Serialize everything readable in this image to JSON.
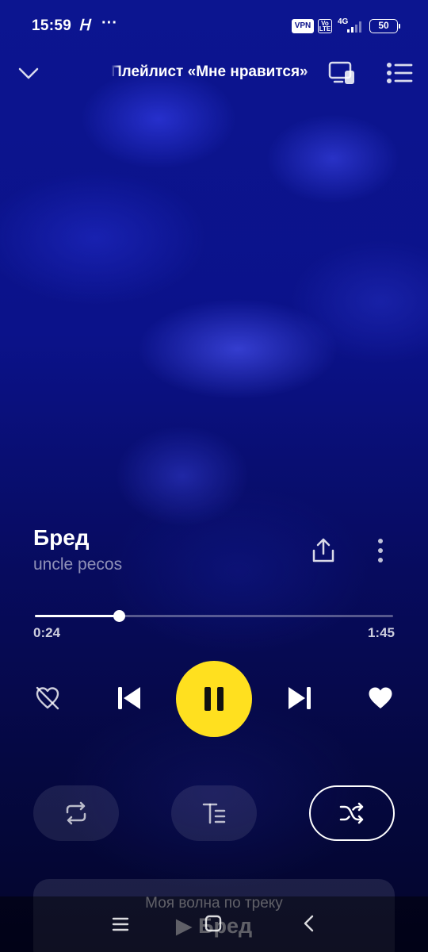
{
  "status_bar": {
    "time": "15:59",
    "glyph": "Ꮋ",
    "dots": "···",
    "vpn": "VPN",
    "volte": "Vo LTE",
    "network": "4G",
    "battery": "50"
  },
  "header": {
    "title": "Плейлист «Мне нравится»",
    "icons": [
      "chevron-down-icon",
      "device-icon",
      "queue-list-icon"
    ]
  },
  "track": {
    "title": "Бред",
    "artist": "uncle pecos"
  },
  "progress": {
    "current": "0:24",
    "total": "1:45",
    "fraction": 0.235
  },
  "controls": {
    "play_state": "playing",
    "icons": [
      "dislike-icon",
      "previous-icon",
      "pause-icon",
      "next-icon",
      "heart-icon",
      "repeat-icon",
      "lyrics-icon",
      "shuffle-icon"
    ]
  },
  "my_wave": {
    "label": "Моя волна по треку",
    "track": "▶ Бред"
  },
  "colors": {
    "accent": "#ffe01f",
    "background": "#0b128a"
  }
}
